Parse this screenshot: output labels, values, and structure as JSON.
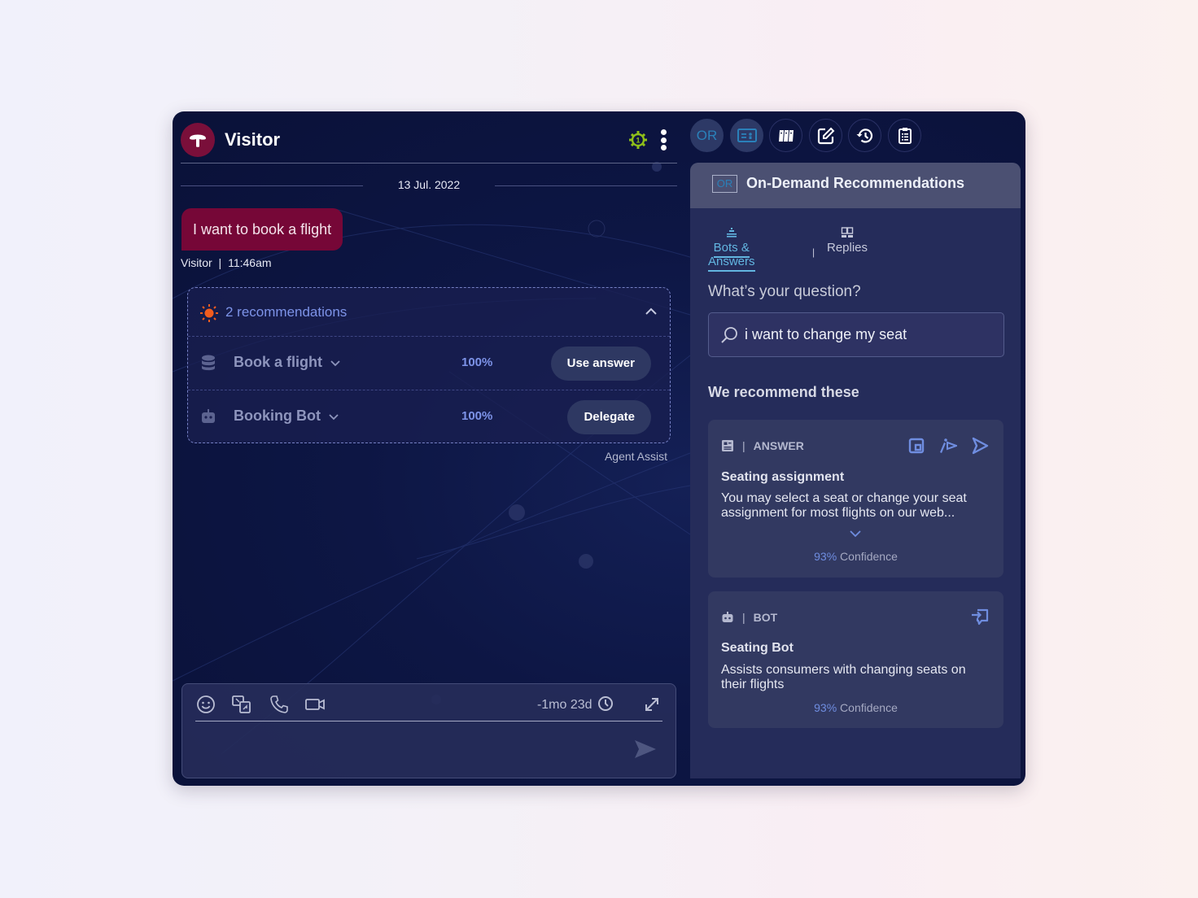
{
  "colors": {
    "accent_blue": "#7d93e8",
    "tab_active": "#62b6e1",
    "bubble": "#760737",
    "avatar": "#7a0f3a",
    "gear_status": "#8fbf1a",
    "recommendation_sun": "#f25c1e"
  },
  "chat": {
    "header": {
      "title": "Visitor",
      "avatar_icon": "mushroom-logo-icon",
      "status_icon": "gear-badge-icon",
      "status_count": "1",
      "menu_icon": "kebab-menu-icon"
    },
    "date_divider": "13 Jul. 2022",
    "message": {
      "text": "I want to book a flight",
      "sender": "Visitor",
      "separator": "|",
      "time": "11:46am"
    },
    "recommendations": {
      "count_label": "2 recommendations",
      "items": [
        {
          "icon": "database-icon",
          "title": "Book a flight",
          "score": "100%",
          "action": "Use answer"
        },
        {
          "icon": "bot-icon",
          "title": "Booking Bot",
          "score": "100%",
          "action": "Delegate"
        }
      ],
      "footer": "Agent Assist"
    },
    "composer": {
      "tools": [
        "emoji-icon",
        "translate-icon",
        "phone-icon",
        "video-icon"
      ],
      "timer": "-1mo 23d",
      "timer_icon": "clock-icon",
      "expand_icon": "expand-icon",
      "send_icon": "send-icon",
      "placeholder": ""
    }
  },
  "side": {
    "toolbar": [
      {
        "name": "on-demand-recommendations",
        "label": "OR",
        "active": true
      },
      {
        "name": "contact-card",
        "label": "",
        "active": true
      },
      {
        "name": "library",
        "label": "",
        "active": false
      },
      {
        "name": "notes",
        "label": "",
        "active": false
      },
      {
        "name": "history",
        "label": "",
        "active": false
      },
      {
        "name": "clipboard",
        "label": "",
        "active": false
      }
    ],
    "panel": {
      "badge": "OR",
      "title": "On-Demand Recommendations",
      "tabs": [
        {
          "label": "Bots & Answers",
          "active": true
        },
        {
          "label": "Replies",
          "active": false
        }
      ],
      "tab_separator": "|",
      "question_label": "What’s your question?",
      "search_value": "i want to change my seat",
      "recommend_label": "We recommend these",
      "cards": [
        {
          "kind": "ANSWER",
          "title": "Seating assignment",
          "body": "You may select a seat or change your seat assignment for most flights on our web...",
          "confidence_value": "93%",
          "confidence_label": "Confidence",
          "actions": [
            "copy-icon",
            "edit-send-icon",
            "send-icon"
          ]
        },
        {
          "kind": "BOT",
          "title": "Seating Bot",
          "body": "Assists consumers with changing seats on their flights",
          "confidence_value": "93%",
          "confidence_label": "Confidence",
          "actions": [
            "transfer-icon"
          ]
        }
      ]
    }
  }
}
